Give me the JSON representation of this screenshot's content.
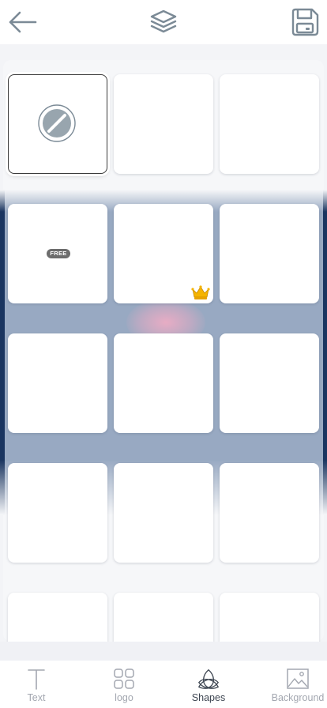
{
  "colors": {
    "band": "#98a9c2",
    "band_edge": "#1a3560",
    "icon_gray": "#7b8a96",
    "tab_inactive": "#a3a7b0",
    "tab_active": "#3e4652",
    "badge": "#6d6d6d",
    "crown": "#f5b400"
  },
  "topbar": {
    "back_icon": "arrow-left-icon",
    "layers_icon": "layers-icon",
    "save_icon": "floppy-disk-icon"
  },
  "grid": {
    "tiles": [
      {
        "kind": "none",
        "selected": true,
        "icon": "no-shape-icon"
      },
      {
        "kind": "empty"
      },
      {
        "kind": "empty"
      },
      {
        "kind": "free",
        "badge": "FREE"
      },
      {
        "kind": "premium",
        "icon": "crown-icon"
      },
      {
        "kind": "empty"
      },
      {
        "kind": "empty"
      },
      {
        "kind": "empty"
      },
      {
        "kind": "empty"
      },
      {
        "kind": "empty"
      },
      {
        "kind": "empty"
      },
      {
        "kind": "empty"
      },
      {
        "kind": "empty"
      },
      {
        "kind": "empty"
      },
      {
        "kind": "empty"
      }
    ]
  },
  "tabbar": {
    "active_index": 2,
    "tabs": [
      {
        "label": "Text",
        "icon": "text-icon"
      },
      {
        "label": "logo",
        "icon": "logo-grid-icon"
      },
      {
        "label": "Shapes",
        "icon": "shapes-icon"
      },
      {
        "label": "Background",
        "icon": "image-icon"
      }
    ]
  }
}
